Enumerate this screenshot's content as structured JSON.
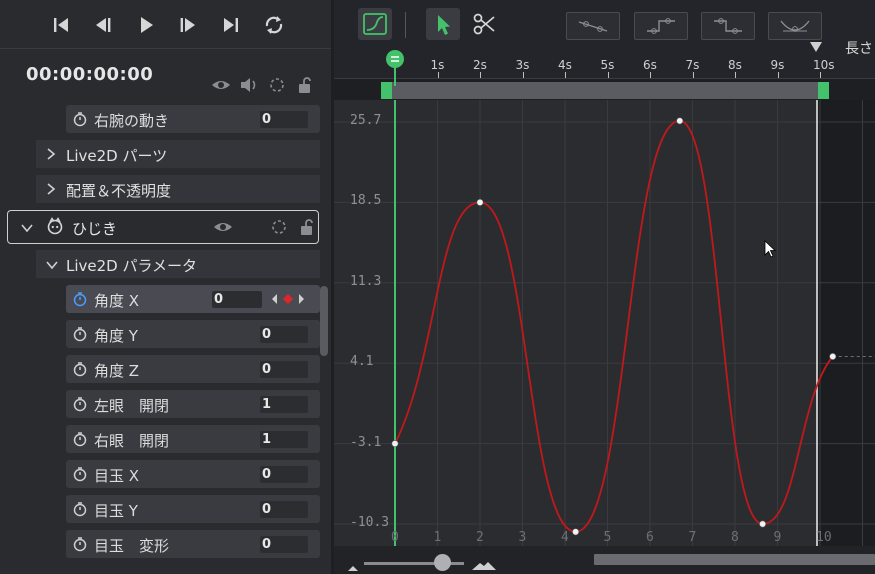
{
  "timecode": "00:00:00:00",
  "params_top": [
    {
      "label": "右腕の動き",
      "value": "0"
    }
  ],
  "groups_top": [
    {
      "label": "Live2D パーツ"
    },
    {
      "label": "配置＆不透明度"
    }
  ],
  "object": {
    "label": "ひじき"
  },
  "group_params": {
    "label": "Live2D パラメータ"
  },
  "params": [
    {
      "label": "角度 X",
      "value": "0"
    },
    {
      "label": "角度 Y",
      "value": "0"
    },
    {
      "label": "角度 Z",
      "value": "0"
    },
    {
      "label": "左眼　開閉",
      "value": "1"
    },
    {
      "label": "右眼　開閉",
      "value": "1"
    },
    {
      "label": "目玉 X",
      "value": "0"
    },
    {
      "label": "目玉 Y",
      "value": "0"
    },
    {
      "label": "目玉　変形",
      "value": "0"
    }
  ],
  "toolbar": {
    "length_label": "長さ"
  },
  "ruler": {
    "labels": [
      "0",
      "1s",
      "2s",
      "3s",
      "4s",
      "5s",
      "6s",
      "7s",
      "8s",
      "9s",
      "10s"
    ]
  },
  "graph": {
    "y_labels": [
      "25.7",
      "18.5",
      "11.3",
      "4.1",
      "-3.1",
      "-10.3"
    ],
    "x_labels": [
      "0",
      "1",
      "2",
      "3",
      "4",
      "5",
      "6",
      "7",
      "8",
      "9",
      "10"
    ],
    "colors": {
      "curve": "#c0191b",
      "playhead": "#43c26b",
      "grid": "#3a3b40",
      "end_marker": "#bfbfbf"
    }
  },
  "chart_data": {
    "type": "line",
    "x": [
      0,
      2.0,
      4.25,
      6.7,
      8.65,
      10.3
    ],
    "series": [
      {
        "values": [
          -3.1,
          18.5,
          -11.0,
          25.8,
          -10.3,
          4.7
        ]
      }
    ],
    "xlim": [
      0,
      11
    ],
    "ylim": [
      -11.5,
      26.5
    ]
  }
}
